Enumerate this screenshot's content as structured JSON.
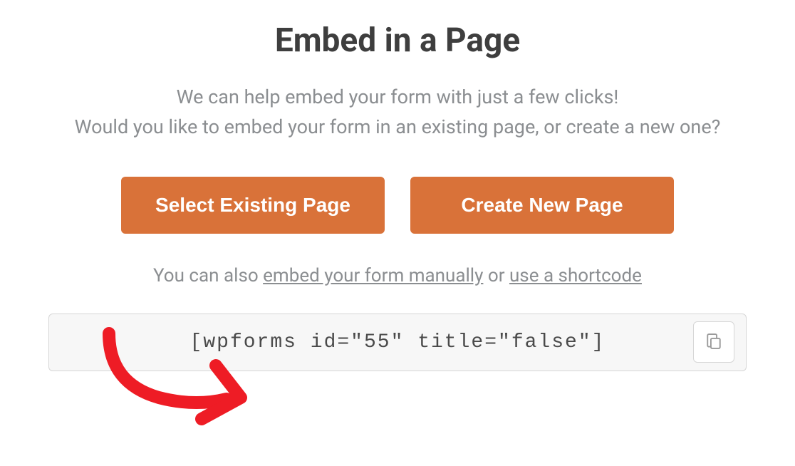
{
  "title": "Embed in a Page",
  "description_line1": "We can help embed your form with just a few clicks!",
  "description_line2": "Would you like to embed your form in an existing page, or create a new one?",
  "buttons": {
    "select_existing": "Select Existing Page",
    "create_new": "Create New Page"
  },
  "helper": {
    "prefix": "You can also ",
    "link_manual": "embed your form manually",
    "middle": " or ",
    "link_shortcode": "use a shortcode"
  },
  "shortcode": "[wpforms id=\"55\" title=\"false\"]",
  "colors": {
    "accent": "#d97239"
  }
}
